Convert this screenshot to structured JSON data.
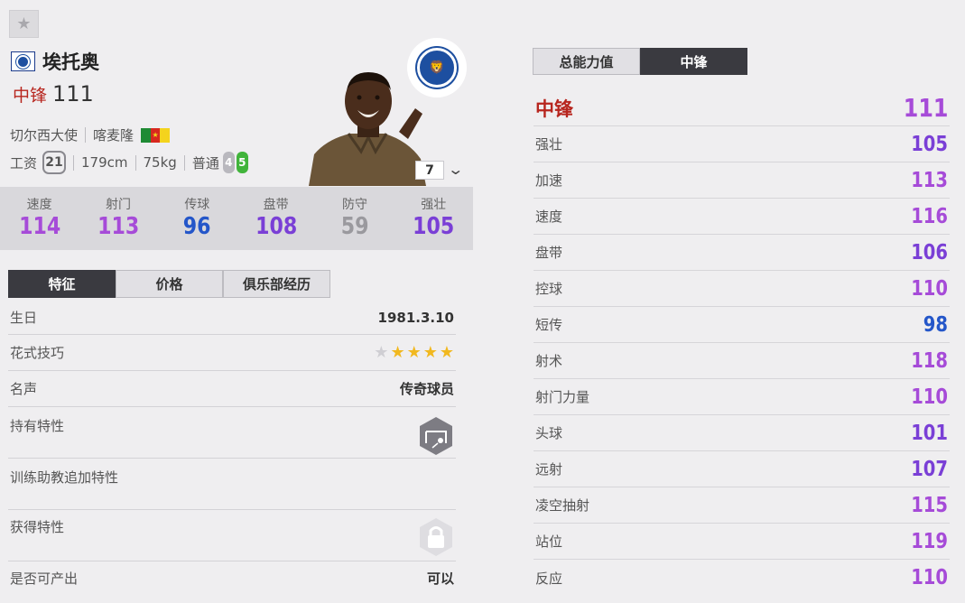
{
  "player": {
    "name": "埃托奥",
    "position": "中锋",
    "overall": "111",
    "season": "切尔西大使",
    "nation": "喀麦隆",
    "wage_label": "工资",
    "wage": "21",
    "height": "179cm",
    "weight": "75kg",
    "body_type": "普通",
    "weak_foot": "4",
    "strong_foot": "5",
    "grade": "7"
  },
  "summary_stats": [
    {
      "label": "速度",
      "value": "114",
      "color": "#a64bd8"
    },
    {
      "label": "射门",
      "value": "113",
      "color": "#a64bd8"
    },
    {
      "label": "传球",
      "value": "96",
      "color": "#2456c9"
    },
    {
      "label": "盘带",
      "value": "108",
      "color": "#7a3fd6"
    },
    {
      "label": "防守",
      "value": "59",
      "color": "#9a999e"
    },
    {
      "label": "强壮",
      "value": "105",
      "color": "#7a3fd6"
    }
  ],
  "left_tabs": [
    "特征",
    "价格",
    "俱乐部经历"
  ],
  "details": {
    "birthday_label": "生日",
    "birthday": "1981.3.10",
    "skill_label": "花式技巧",
    "skill_stars": 4,
    "reputation_label": "名声",
    "reputation": "传奇球员",
    "traits_label": "持有特性",
    "coach_traits_label": "训练助教追加特性",
    "acquired_traits_label": "获得特性",
    "tradeable_label": "是否可产出",
    "tradeable": "可以"
  },
  "right_tabs": [
    "总能力值",
    "中锋"
  ],
  "position_detail": {
    "title": "中锋",
    "overall": "111",
    "attributes": [
      {
        "label": "强壮",
        "value": "105",
        "color": "#7a3fd6"
      },
      {
        "label": "加速",
        "value": "113",
        "color": "#a64bd8"
      },
      {
        "label": "速度",
        "value": "116",
        "color": "#a64bd8"
      },
      {
        "label": "盘带",
        "value": "106",
        "color": "#7a3fd6"
      },
      {
        "label": "控球",
        "value": "110",
        "color": "#a64bd8"
      },
      {
        "label": "短传",
        "value": "98",
        "color": "#2456c9"
      },
      {
        "label": "射术",
        "value": "118",
        "color": "#a64bd8"
      },
      {
        "label": "射门力量",
        "value": "110",
        "color": "#a64bd8"
      },
      {
        "label": "头球",
        "value": "101",
        "color": "#7a3fd6"
      },
      {
        "label": "远射",
        "value": "107",
        "color": "#7a3fd6"
      },
      {
        "label": "凌空抽射",
        "value": "115",
        "color": "#a64bd8"
      },
      {
        "label": "站位",
        "value": "119",
        "color": "#a64bd8"
      },
      {
        "label": "反应",
        "value": "110",
        "color": "#a64bd8"
      }
    ]
  }
}
